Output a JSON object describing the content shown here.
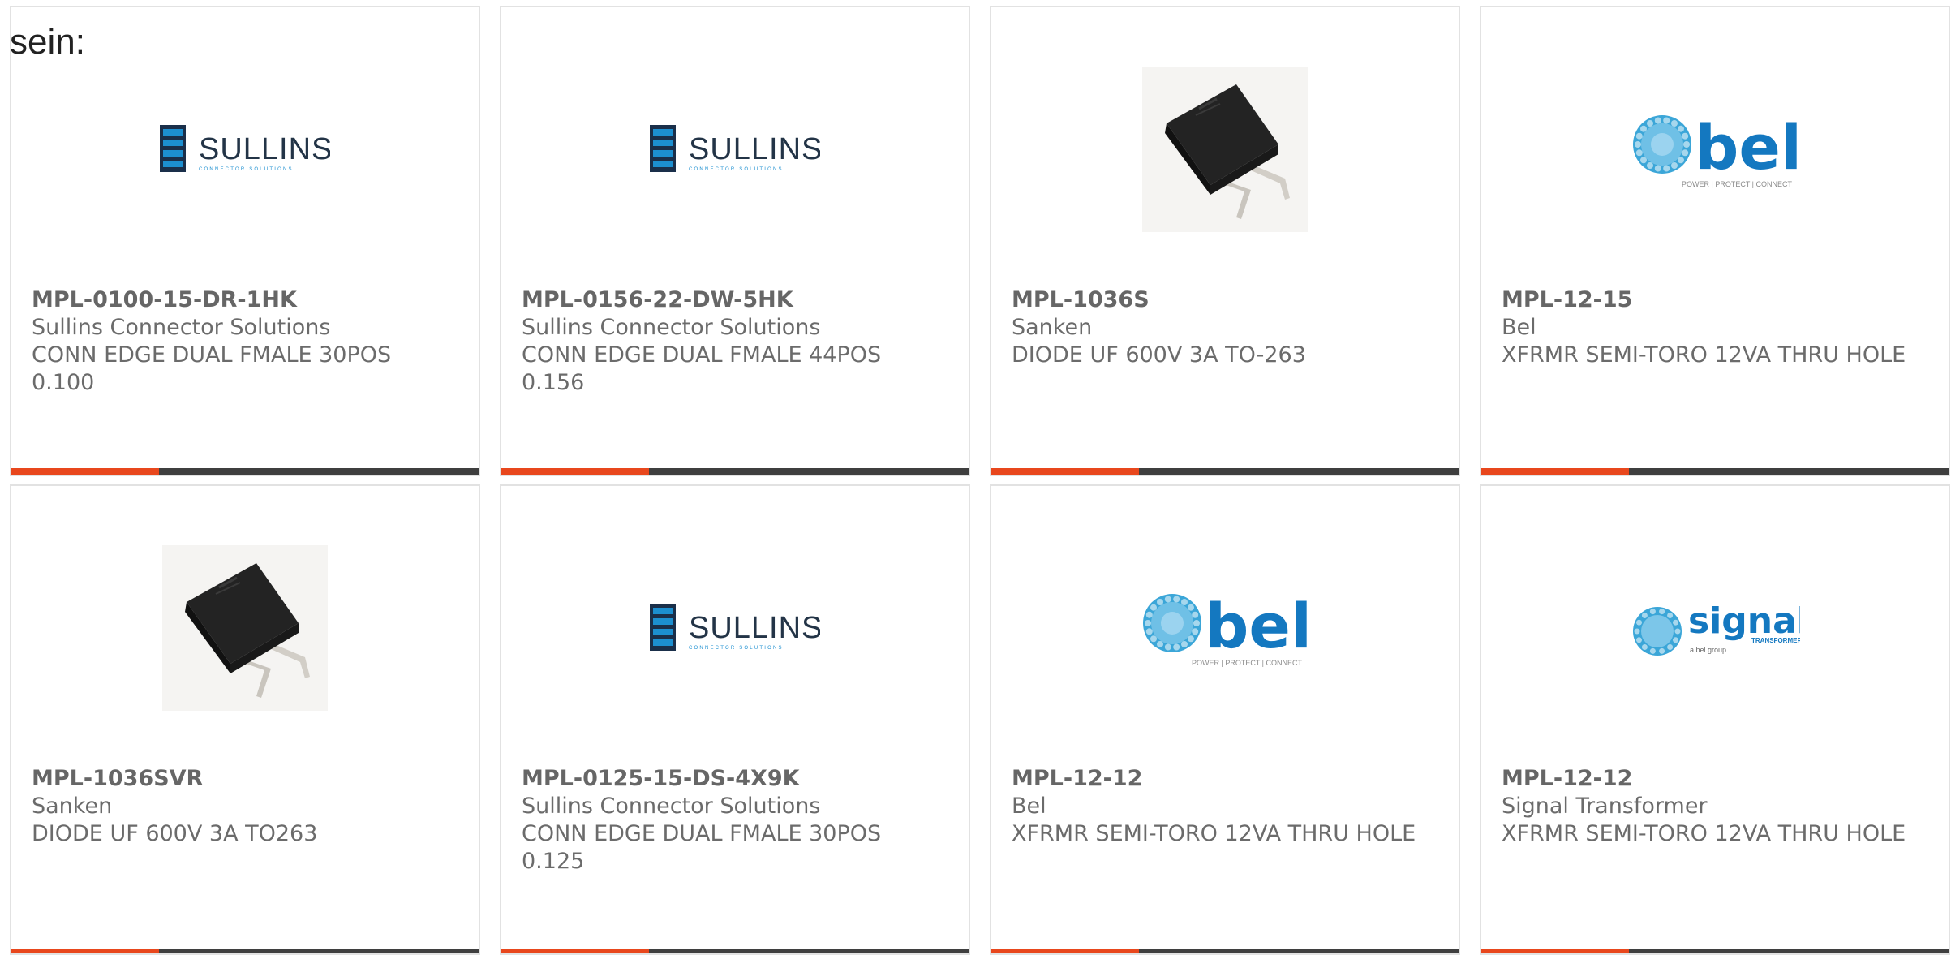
{
  "intro_text": "sein:",
  "colors": {
    "accent": "#e8471d",
    "bar": "#3f3f3f",
    "card_border": "#e2e2e2",
    "text": "#6b6b6b"
  },
  "cards": [
    {
      "image": "sullins-logo",
      "part_number": "MPL-0100-15-DR-1HK",
      "manufacturer": "Sullins Connector Solutions",
      "description": "CONN EDGE DUAL FMALE 30POS 0.100",
      "logo_text": "SULLINS",
      "logo_tagline": "CONNECTOR SOLUTIONS"
    },
    {
      "image": "sullins-logo",
      "part_number": "MPL-0156-22-DW-5HK",
      "manufacturer": "Sullins Connector Solutions",
      "description": "CONN EDGE DUAL FMALE 44POS 0.156",
      "logo_text": "SULLINS",
      "logo_tagline": "CONNECTOR SOLUTIONS"
    },
    {
      "image": "to263-package-photo",
      "part_number": "MPL-1036S",
      "manufacturer": "Sanken",
      "description": "DIODE UF 600V 3A TO-263"
    },
    {
      "image": "bel-logo",
      "part_number": "MPL-12-15",
      "manufacturer": "Bel",
      "description": "XFRMR SEMI-TORO 12VA THRU HOLE",
      "logo_text": "bel",
      "logo_tagline": "POWER | PROTECT | CONNECT"
    },
    {
      "image": "to263-package-photo",
      "part_number": "MPL-1036SVR",
      "manufacturer": "Sanken",
      "description": "DIODE UF 600V 3A TO263"
    },
    {
      "image": "sullins-logo",
      "part_number": "MPL-0125-15-DS-4X9K",
      "manufacturer": "Sullins Connector Solutions",
      "description": "CONN EDGE DUAL FMALE 30POS 0.125",
      "logo_text": "SULLINS",
      "logo_tagline": "CONNECTOR SOLUTIONS"
    },
    {
      "image": "bel-logo",
      "part_number": "MPL-12-12",
      "manufacturer": "Bel",
      "description": "XFRMR SEMI-TORO 12VA THRU HOLE",
      "logo_text": "bel",
      "logo_tagline": "POWER | PROTECT | CONNECT"
    },
    {
      "image": "signal-transformer-logo",
      "part_number": "MPL-12-12",
      "manufacturer": "Signal Transformer",
      "description": "XFRMR SEMI-TORO 12VA THRU HOLE",
      "logo_text": "signal",
      "logo_tagline": "TRANSFORMER",
      "logo_subtagline": "a bel group"
    }
  ]
}
